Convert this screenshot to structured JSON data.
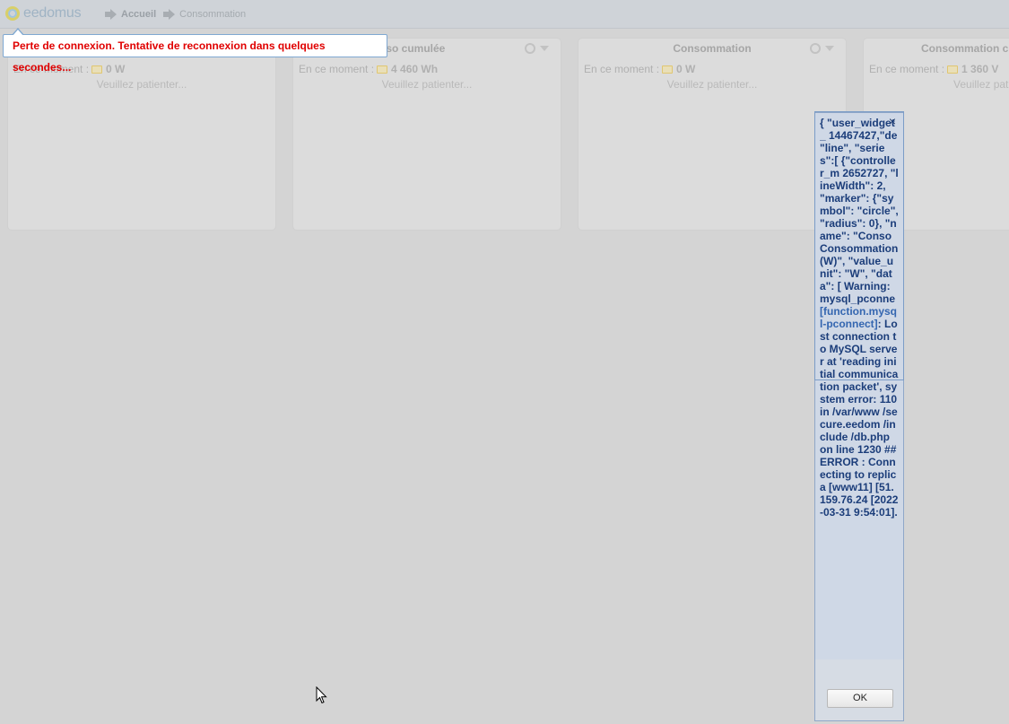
{
  "header": {
    "logo_text": "eedomus",
    "breadcrumb": {
      "home": "Accueil",
      "current": "Consommation"
    }
  },
  "connection_tooltip": "Perte de connexion. Tentative de reconnexion dans quelques secondes...",
  "widgets": [
    {
      "title": "",
      "now_label": "En ce moment :",
      "value": "0 W",
      "loading": "Veuillez patienter..."
    },
    {
      "title": "nso cumulée",
      "now_label": "En ce moment :",
      "value": "4 460 Wh",
      "loading": "Veuillez patienter..."
    },
    {
      "title": "Consommation",
      "now_label": "En ce moment :",
      "value": "0 W",
      "loading": "Veuillez patienter..."
    },
    {
      "title": "Consommation cu",
      "now_label": "En ce moment :",
      "value": "1 360 V",
      "loading": "Veuillez patienter..."
    }
  ],
  "error_dialog": {
    "close_symbol": "×",
    "text_part1": "{ \"user_widget_ 14467427,\"de \"line\", \"series\":[ {\"controller_m 2652727, \"lineWidth\": 2, \"marker\": {\"symbol\": \"circle\", \"radius\": 0}, \"name\": \"Conso Consommation (W)\", \"value_unit\": \"W\", \"data\": [ Warning: mysql_pconne ",
    "link_text": "[function.mysql-pconnect]",
    "text_part2": ": Lost connection to MySQL server at 'reading initial communication packet', system error: 110 in /var/www /secure.eedom /include /db.php on line 1230 ## ERROR : Connecting to replica [www11] [51.159.76.24 [2022-03-31 9:54:01].",
    "ok_label": "OK"
  },
  "colors": {
    "background": "#d4d4d4",
    "error_text": "#e00000",
    "dialog_text": "#1b3d7a",
    "dialog_bg": "#cfd8e6"
  }
}
